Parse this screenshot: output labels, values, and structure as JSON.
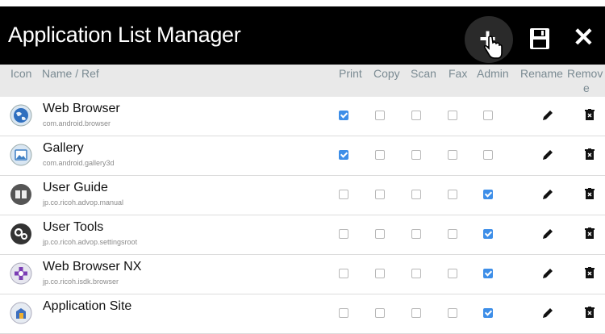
{
  "header": {
    "title": "Application List Manager",
    "add_icon": "plus-icon",
    "save_icon": "save-icon",
    "close_icon": "close-icon"
  },
  "columns": {
    "icon": "Icon",
    "name": "Name / Ref",
    "print": "Print",
    "copy": "Copy",
    "scan": "Scan",
    "fax": "Fax",
    "admin": "Admin",
    "rename": "Rename",
    "remove_line1": "Remov",
    "remove_line2": "e"
  },
  "colors": {
    "accent": "#3d8ee8",
    "header_bg": "#000000",
    "column_header_bg": "#e9e9e9"
  },
  "rows": [
    {
      "name": "Web Browser",
      "ref": "com.android.browser",
      "icon": "globe-icon",
      "print": true,
      "copy": false,
      "scan": false,
      "fax": false,
      "admin": false
    },
    {
      "name": "Gallery",
      "ref": "com.android.gallery3d",
      "icon": "gallery-icon",
      "print": true,
      "copy": false,
      "scan": false,
      "fax": false,
      "admin": false
    },
    {
      "name": "User Guide",
      "ref": "jp.co.ricoh.advop.manual",
      "icon": "book-icon",
      "print": false,
      "copy": false,
      "scan": false,
      "fax": false,
      "admin": true
    },
    {
      "name": "User Tools",
      "ref": "jp.co.ricoh.advop.settingsroot",
      "icon": "gears-icon",
      "print": false,
      "copy": false,
      "scan": false,
      "fax": false,
      "admin": true
    },
    {
      "name": "Web Browser NX",
      "ref": "jp.co.ricoh.isdk.browser",
      "icon": "browser-nx-icon",
      "print": false,
      "copy": false,
      "scan": false,
      "fax": false,
      "admin": true
    },
    {
      "name": "Application Site",
      "ref": "",
      "icon": "app-site-icon",
      "print": false,
      "copy": false,
      "scan": false,
      "fax": false,
      "admin": true
    }
  ]
}
